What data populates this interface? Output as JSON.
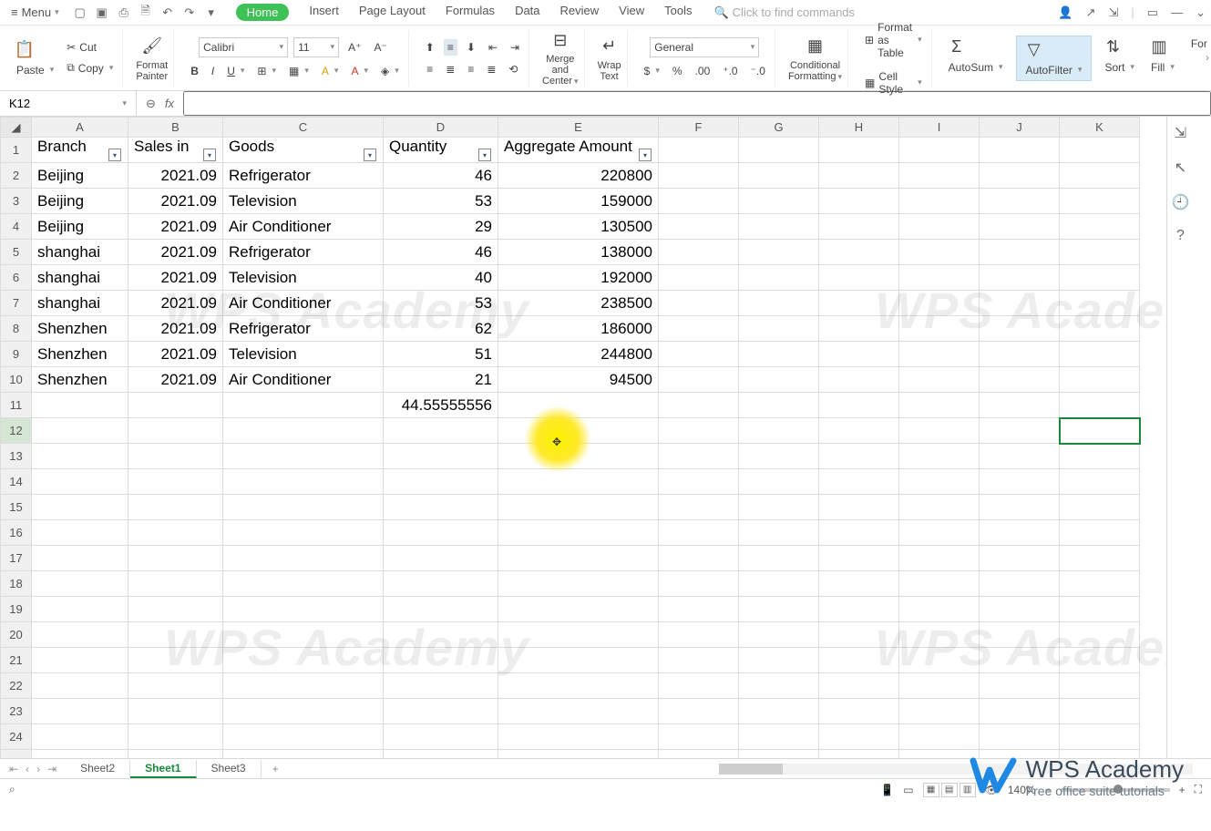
{
  "menubar": {
    "menu_label": "Menu",
    "tabs": [
      "Home",
      "Insert",
      "Page Layout",
      "Formulas",
      "Data",
      "Review",
      "View",
      "Tools"
    ],
    "active_tab": "Home",
    "search_placeholder": "Click to find commands"
  },
  "ribbon": {
    "paste": "Paste",
    "cut": "Cut",
    "copy": "Copy",
    "format_painter": "Format\nPainter",
    "font_name": "Calibri",
    "font_size": "11",
    "merge_center": "Merge and\nCenter",
    "wrap_text": "Wrap\nText",
    "number_format": "General",
    "conditional": "Conditional\nFormatting",
    "format_table": "Format as Table",
    "cell_style": "Cell Style",
    "autosum": "AutoSum",
    "autofilter": "AutoFilter",
    "sort": "Sort",
    "fill": "Fill",
    "for": "For"
  },
  "formula_bar": {
    "cell_ref": "K12",
    "formula": ""
  },
  "columns": [
    "A",
    "B",
    "C",
    "D",
    "E",
    "F",
    "G",
    "H",
    "I",
    "J",
    "K"
  ],
  "headers": {
    "A": "Branch",
    "B": "Sales in",
    "C": "Goods",
    "D": "Quantity",
    "E": "Aggregate Amount"
  },
  "rows": [
    {
      "n": 2,
      "A": "Beijing",
      "B": "2021.09",
      "C": "Refrigerator",
      "D": 46,
      "E": 220800
    },
    {
      "n": 3,
      "A": "Beijing",
      "B": "2021.09",
      "C": "Television",
      "D": 53,
      "E": 159000
    },
    {
      "n": 4,
      "A": "Beijing",
      "B": "2021.09",
      "C": "Air Conditioner",
      "D": 29,
      "E": 130500
    },
    {
      "n": 5,
      "A": "shanghai",
      "B": "2021.09",
      "C": "Refrigerator",
      "D": 46,
      "E": 138000
    },
    {
      "n": 6,
      "A": "shanghai",
      "B": "2021.09",
      "C": "Television",
      "D": 40,
      "E": 192000
    },
    {
      "n": 7,
      "A": "shanghai",
      "B": "2021.09",
      "C": "Air Conditioner",
      "D": 53,
      "E": 238500
    },
    {
      "n": 8,
      "A": "Shenzhen",
      "B": "2021.09",
      "C": "Refrigerator",
      "D": 62,
      "E": 186000
    },
    {
      "n": 9,
      "A": "Shenzhen",
      "B": "2021.09",
      "C": "Television",
      "D": 51,
      "E": 244800
    },
    {
      "n": 10,
      "A": "Shenzhen",
      "B": "2021.09",
      "C": "Air Conditioner",
      "D": 21,
      "E": 94500
    }
  ],
  "d11": "44.55555556",
  "selected_cell": "K12",
  "selected_row": 12,
  "selected_col": "K",
  "sheets": [
    "Sheet2",
    "Sheet1",
    "Sheet3"
  ],
  "active_sheet": "Sheet1",
  "status": {
    "zoom": "140%"
  },
  "watermark": "WPS Academy",
  "logo": {
    "title": "WPS Academy",
    "sub": "Free office suite tutorials"
  }
}
